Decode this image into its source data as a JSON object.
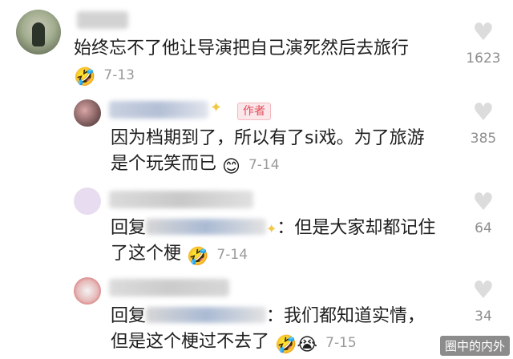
{
  "comments": [
    {
      "text": "始终忘不了他让导演把自己演死然后去旅行",
      "date": "7-13",
      "likes": "1623",
      "emoji": "🤣"
    },
    {
      "author_badge": "作者",
      "line1": "因为档期到了，所以有了si戏。为了旅游",
      "line2": "是个玩笑而已",
      "date": "7-14",
      "likes": "385",
      "emoji": "😊"
    },
    {
      "line1_prefix": "回复",
      "line1_suffix": "：但是大家却都记住",
      "line2": "了这个梗",
      "date": "7-14",
      "likes": "64",
      "emoji": "🤣"
    },
    {
      "line1_prefix": "回复",
      "line1_suffix": "：我们都知道实情，",
      "line2": "但是这个梗过不去了",
      "date": "7-15",
      "likes": "34",
      "emoji1": "🤣",
      "emoji2": "😭"
    }
  ],
  "icons": {
    "like": "heart-icon",
    "sparkle": "sparkle-icon"
  },
  "colors": {
    "author_badge_text": "#e34a5a",
    "author_badge_bg": "#fbe7e9",
    "date": "#9a9a9a",
    "like_icon": "#dcdcdc"
  },
  "watermark": "圈中的内外"
}
